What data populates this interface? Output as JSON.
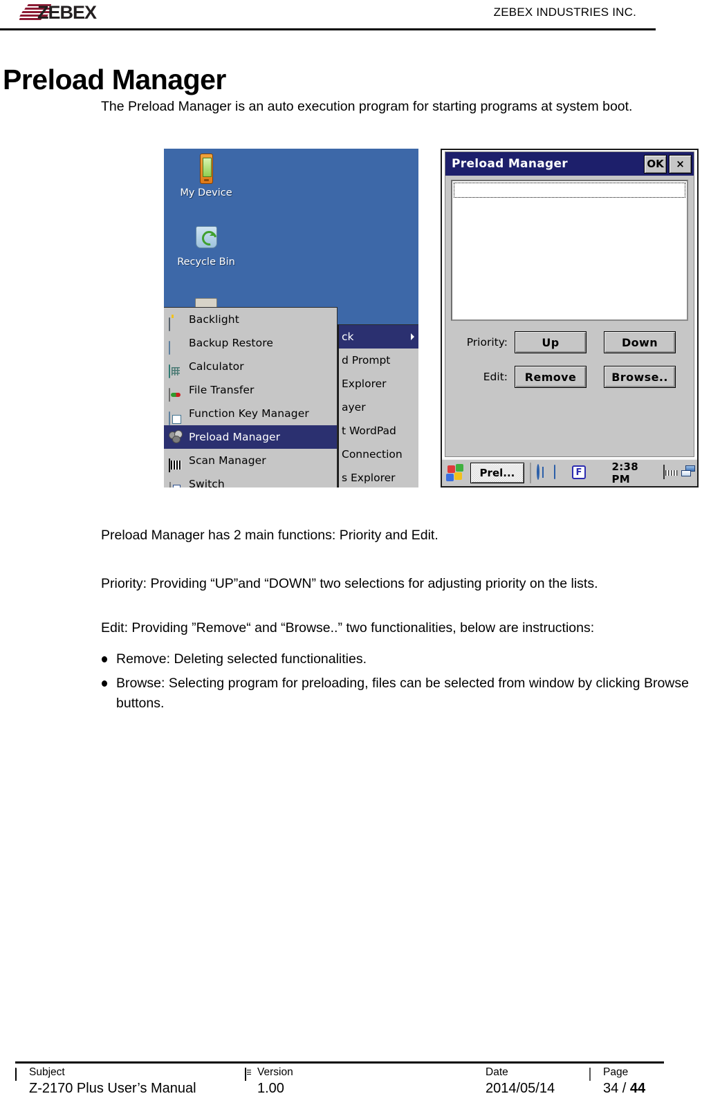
{
  "header": {
    "logo_text": "ZEBEX",
    "company": "ZEBEX INDUSTRIES INC."
  },
  "title": "Preload Manager",
  "paragraphs": {
    "intro": "The Preload Manager is an auto execution program for starting programs at system boot.",
    "two_functions": "Preload Manager has 2 main functions: Priority and Edit.",
    "priority": "Priority: Providing “UP”and “DOWN” two selections for adjusting priority on the lists.",
    "edit": "Edit: Providing ”Remove“ and “Browse..” two functionalities, below are instructions:",
    "bullet_remove": "Remove: Deleting selected functionalities.",
    "bullet_browse": "Browse: Selecting program for preloading, files can be selected from window by clicking Browse buttons."
  },
  "screenshot_left": {
    "name": "device-desktop-start-menu",
    "desktop_icons": [
      {
        "label": "My Device",
        "icon": "pda-device-icon"
      },
      {
        "label": "Recycle Bin",
        "icon": "recycle-bin-icon"
      },
      {
        "label": "",
        "icon": "folder-icon"
      }
    ],
    "start_menu": [
      {
        "label": "Backlight",
        "icon": "backlight-icon",
        "selected": false
      },
      {
        "label": "Backup Restore",
        "icon": "backup-restore-icon",
        "selected": false
      },
      {
        "label": "Calculator",
        "icon": "calculator-icon",
        "selected": false
      },
      {
        "label": "File Transfer",
        "icon": "file-transfer-icon",
        "selected": false
      },
      {
        "label": "Function Key Manager",
        "icon": "function-key-manager-icon",
        "selected": false
      },
      {
        "label": "Preload Manager",
        "icon": "preload-manager-icon",
        "selected": true
      },
      {
        "label": "Scan Manager",
        "icon": "scan-manager-icon",
        "selected": false
      },
      {
        "label": "Switch",
        "icon": "switch-icon",
        "selected": false
      }
    ],
    "sub_menu": [
      {
        "label": "ck",
        "selected": true,
        "has_arrow": true
      },
      {
        "label": "d Prompt",
        "selected": false,
        "has_arrow": false
      },
      {
        "label": " Explorer",
        "selected": false,
        "has_arrow": false
      },
      {
        "label": "ayer",
        "selected": false,
        "has_arrow": false
      },
      {
        "label": "t WordPad",
        "selected": false,
        "has_arrow": false
      },
      {
        "label": "Connection",
        "selected": false,
        "has_arrow": false
      },
      {
        "label": "s Explorer",
        "selected": false,
        "has_arrow": false
      }
    ]
  },
  "screenshot_right": {
    "name": "preload-manager-dialog",
    "window_title": "Preload Manager",
    "ok_label": "OK",
    "close_label": "×",
    "list_items": [],
    "priority_label": "Priority:",
    "edit_label": "Edit:",
    "buttons": {
      "up": "Up",
      "down": "Down",
      "remove": "Remove",
      "browse": "Browse.."
    },
    "taskbar": {
      "task_button": "Prel...",
      "clock": "2:38 PM",
      "f_key": "F",
      "tray_icons": [
        "network-icon",
        "pc-connection-icon",
        "f-mode-icon",
        "barcode-icon",
        "keyboard-icon",
        "windows-tasks-icon"
      ]
    }
  },
  "footer": {
    "subject_head": "Subject",
    "subject_value": "Z-2170 Plus User’s Manual",
    "version_head": "Version",
    "version_value": "1.00",
    "date_head": "Date",
    "date_value": "2014/05/14",
    "page_head": "Page",
    "page_current": "34",
    "page_sep": " / ",
    "page_total": "44"
  },
  "colors": {
    "desktop_blue": "#3d68a8",
    "menu_gray": "#c6c6c6",
    "selection_navy": "#2b3070",
    "titlebar_navy": "#1d1f6b",
    "logo_red": "#8c1b34"
  }
}
